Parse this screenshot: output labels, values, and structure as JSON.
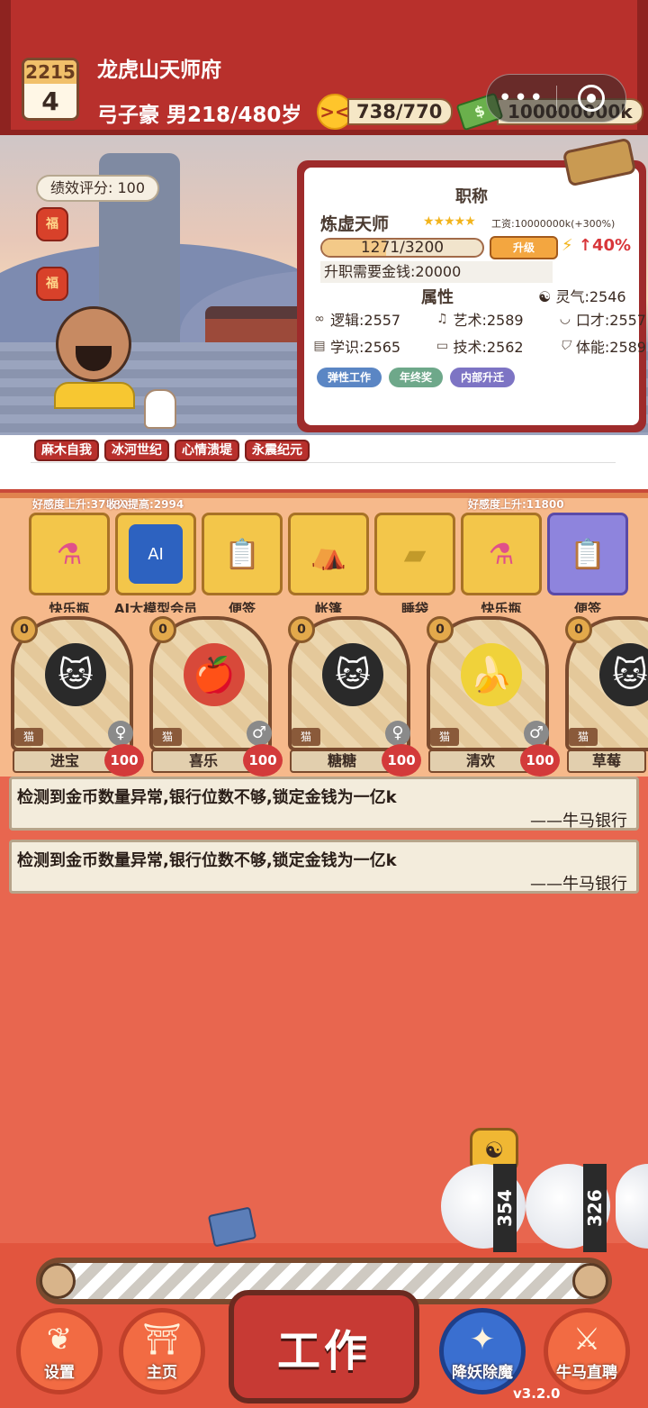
{
  "header": {
    "calendar_year": "2215",
    "calendar_day": "4",
    "location": "龙虎山天师府",
    "player_info": "弓子豪 男218/480岁",
    "mood_icon": "smiley-face-icon",
    "mood_value": "738/770",
    "money_icon": "cash-icon",
    "money_value": "100000000k",
    "capsule_dots": "•••"
  },
  "scene": {
    "performance_label": "绩效评分:",
    "performance_value": "100",
    "lantern_text": "福"
  },
  "title_card": {
    "section_title": "职称",
    "job_name": "炼虚天师",
    "stars": "★★★★★",
    "salary": "工资:10000000k(+300%)",
    "xp_text": "1271/3200",
    "xp_fraction": 0.397,
    "promote_label": "升级",
    "bonus": "↑40%",
    "required_money": "升职需要金钱:20000",
    "attributes_title": "属性",
    "lingqi": "灵气:2546",
    "attributes": [
      {
        "icon": "link-icon",
        "text": "逻辑:2557"
      },
      {
        "icon": "music-note-icon",
        "text": "艺术:2589"
      },
      {
        "icon": "lips-icon",
        "text": "口才:2557"
      },
      {
        "icon": "book-icon",
        "text": "学识:2565"
      },
      {
        "icon": "monitor-icon",
        "text": "技术:2562"
      },
      {
        "icon": "shield-icon",
        "text": "体能:2589"
      }
    ],
    "tags": [
      {
        "label": "弹性工作",
        "color": "#5b86c4"
      },
      {
        "label": "年终奖",
        "color": "#6ea88a"
      },
      {
        "label": "内部升迁",
        "color": "#7d74c4"
      }
    ]
  },
  "events": [
    "麻木自我",
    "冰河世纪",
    "心情溃堤",
    "永震纪元"
  ],
  "items": {
    "buffs": [
      "好感度上升:37880",
      "收入提高:2994",
      "好感度上升:11800"
    ],
    "list": [
      {
        "label": "快乐瓶",
        "icon": "potion-icon"
      },
      {
        "label": "AI大模型会员",
        "icon": "ai-card-icon"
      },
      {
        "label": "便签",
        "icon": "clipboard-icon"
      },
      {
        "label": "帐篷",
        "icon": "tent-icon"
      },
      {
        "label": "睡袋",
        "icon": "sleeping-bag-icon"
      },
      {
        "label": "快乐瓶",
        "icon": "potion-icon"
      },
      {
        "label": "便签",
        "icon": "clipboard-icon"
      }
    ]
  },
  "pets": [
    {
      "level": "0",
      "species": "猫",
      "name": "进宝",
      "gender": "♀",
      "affection": "100"
    },
    {
      "level": "0",
      "species": "猫",
      "name": "喜乐",
      "gender": "♂",
      "affection": "100"
    },
    {
      "level": "0",
      "species": "猫",
      "name": "糖糖",
      "gender": "♀",
      "affection": "100"
    },
    {
      "level": "0",
      "species": "猫",
      "name": "清欢",
      "gender": "♂",
      "affection": "100"
    },
    {
      "level": "0",
      "species": "猫",
      "name": "草莓",
      "gender": "",
      "affection": ""
    }
  ],
  "messages": [
    {
      "text": "检测到金币数量异常,银行位数不够,锁定金钱为一亿k",
      "sign": "——牛马银行"
    },
    {
      "text": "检测到金币数量异常,银行位数不够,锁定金钱为一亿k",
      "sign": "——牛马银行"
    }
  ],
  "floating": {
    "yin_yang": "☯",
    "counters": [
      "354",
      "326"
    ]
  },
  "nav": {
    "settings": "设置",
    "home": "主页",
    "work": "工作",
    "exorcise": "降妖除魔",
    "recruit": "牛马直聘",
    "version": "v3.2.0"
  }
}
